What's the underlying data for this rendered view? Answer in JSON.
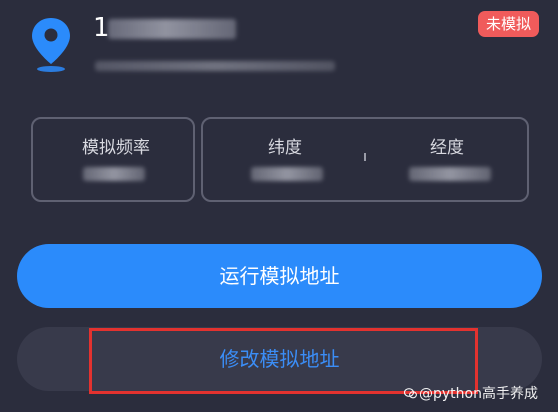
{
  "header": {
    "title_prefix": "1",
    "status_badge": "未模拟"
  },
  "info": {
    "frequency_label": "模拟频率",
    "latitude_label": "纬度",
    "longitude_label": "经度"
  },
  "actions": {
    "run_label": "运行模拟地址",
    "modify_label": "修改模拟地址"
  },
  "watermark": {
    "text": "@python高手养成"
  },
  "colors": {
    "background": "#2b2d3d",
    "primary": "#2b8bfb",
    "badge": "#f05b5b",
    "highlight": "#e3322f"
  },
  "icons": {
    "location": "map-pin-icon"
  }
}
